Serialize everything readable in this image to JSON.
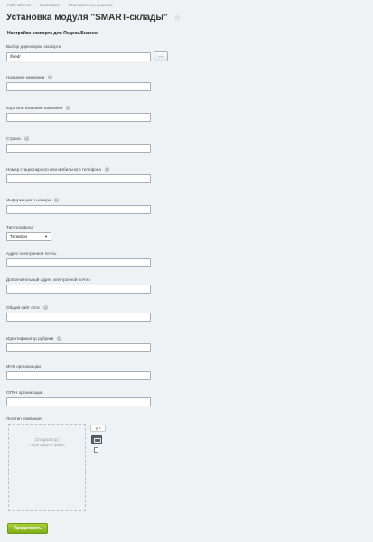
{
  "breadcrumb": [
    "Рабочий стол",
    "Marketplace",
    "Установленные решения"
  ],
  "breadcrumb_separator": "›",
  "page_title": "Установка модуля \"SMART-склады\"",
  "star_icon": "☆",
  "section_title": "Настройки экспорта для Яндекс.Бизнес:",
  "export_dir": {
    "label": "Выбор директории экспорта",
    "value": "/feed/",
    "browse_label": "..."
  },
  "fields": {
    "company_name": {
      "label": "Название компании",
      "value": ""
    },
    "company_short_name": {
      "label": "Короткое название компании",
      "value": ""
    },
    "country": {
      "label": "Страна",
      "value": ""
    },
    "phone": {
      "label": "Номер стационарного или мобильного телефона",
      "value": ""
    },
    "phone_info": {
      "label": "Информация о номере",
      "value": ""
    },
    "phone_type": {
      "label": "Тип телефона",
      "selected": "Телефон"
    },
    "email": {
      "label": "Адрес электронной почты",
      "value": ""
    },
    "extra_email": {
      "label": "Дополнительный адрес электронной почты",
      "value": ""
    },
    "site": {
      "label": "Общий сайт сети",
      "value": ""
    },
    "rubric_id": {
      "label": "Идентификатор рубрики",
      "value": ""
    },
    "inn": {
      "label": "ИНН организации",
      "value": ""
    },
    "ogrn": {
      "label": "ОГРН организации",
      "value": ""
    },
    "logo": {
      "label": "Логотип компании"
    }
  },
  "help_icon": "?",
  "dropzone": {
    "line1": "[Drag&Drop]",
    "line2": "Перетащите файл"
  },
  "submit_label": "Продолжить"
}
